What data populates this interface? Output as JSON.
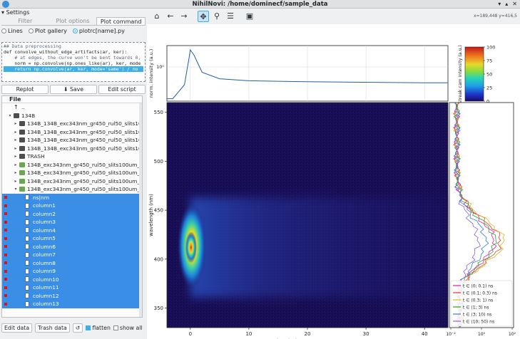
{
  "window": {
    "title": "NihilNovi: /home/dominecf/sample_data"
  },
  "settings": {
    "header": "Settings",
    "tabs": [
      "Filter",
      "Plot options",
      "Plot command"
    ],
    "radios": [
      {
        "label": "Lines",
        "checked": false
      },
      {
        "label": "Plot gallery",
        "checked": false
      },
      {
        "label": "plotrc[name].py",
        "checked": true
      }
    ],
    "code_lines": [
      "## Data preprocessing",
      "def convolve_without_edge_artifacts(ar, ker):",
      "    # at edges, the curve won't be bent towards 0,",
      "    norm = np.convolve(np.ones_like(ar), ker, mode",
      "    return np.convolve(ar, ker, mode='same') / no"
    ],
    "buttons": {
      "replot": "Replot",
      "save": "Save",
      "edit_script": "Edit script"
    }
  },
  "tree": {
    "header": "File",
    "rows": [
      {
        "label": "..",
        "indent": 1,
        "type": "up",
        "arrow": ""
      },
      {
        "label": "134B",
        "indent": 1,
        "type": "folder",
        "arrow": "▾"
      },
      {
        "label": "134B_134B_exc343nm_gr450_rul50_slits100um_5",
        "indent": 2,
        "type": "folder",
        "arrow": "▸"
      },
      {
        "label": "134B_134B_exc343nm_gr450_rul50_slits100um_5",
        "indent": 2,
        "type": "folder",
        "arrow": "▸"
      },
      {
        "label": "134B_134B_exc343nm_gr450_rul50_slits100um_5",
        "indent": 2,
        "type": "folder",
        "arrow": "▸"
      },
      {
        "label": "134B_134B_exc343nm_gr450_rul50_slits100um_5",
        "indent": 2,
        "type": "folder",
        "arrow": "▸"
      },
      {
        "label": "TRASH",
        "indent": 2,
        "type": "folder",
        "arrow": "▸"
      },
      {
        "label": "134B_exc343nm_gr450_rul50_slits100um_50um_",
        "indent": 2,
        "type": "green",
        "arrow": "▸"
      },
      {
        "label": "134B_exc343nm_gr450_rul50_slits100um_50um_",
        "indent": 2,
        "type": "green",
        "arrow": "▸"
      },
      {
        "label": "134B_exc343nm_gr450_rul50_slits100um_50um_",
        "indent": 2,
        "type": "green",
        "arrow": "▸"
      },
      {
        "label": "134B_exc343nm_gr450_rul50_slits100um_50um_",
        "indent": 2,
        "type": "green",
        "arrow": "▾"
      },
      {
        "label": "ns|nm",
        "indent": 3,
        "type": "file",
        "sel": true
      },
      {
        "label": "column1",
        "indent": 3,
        "type": "file",
        "sel": true
      },
      {
        "label": "column2",
        "indent": 3,
        "type": "file",
        "sel": true
      },
      {
        "label": "column3",
        "indent": 3,
        "type": "file",
        "sel": true
      },
      {
        "label": "column4",
        "indent": 3,
        "type": "file",
        "sel": true
      },
      {
        "label": "column5",
        "indent": 3,
        "type": "file",
        "sel": true
      },
      {
        "label": "column6",
        "indent": 3,
        "type": "file",
        "sel": true
      },
      {
        "label": "column7",
        "indent": 3,
        "type": "file",
        "sel": true
      },
      {
        "label": "column8",
        "indent": 3,
        "type": "file",
        "sel": true
      },
      {
        "label": "column9",
        "indent": 3,
        "type": "file",
        "sel": true
      },
      {
        "label": "column10",
        "indent": 3,
        "type": "file",
        "sel": true
      },
      {
        "label": "column11",
        "indent": 3,
        "type": "file",
        "sel": true
      },
      {
        "label": "column12",
        "indent": 3,
        "type": "file",
        "sel": true
      },
      {
        "label": "column13",
        "indent": 3,
        "type": "file",
        "sel": true
      }
    ]
  },
  "bottom": {
    "edit_data": "Edit data",
    "trash_data": "Trash data",
    "refresh": "↺",
    "flatten": "flatten",
    "flatten_checked": true,
    "show_all": "show all",
    "show_all_checked": false
  },
  "toolbar": {
    "tools": [
      {
        "name": "home-icon",
        "glyph": "⌂"
      },
      {
        "name": "back-icon",
        "glyph": "←"
      },
      {
        "name": "forward-icon",
        "glyph": "→"
      },
      {
        "name": "pan-icon",
        "glyph": "✥",
        "active": true
      },
      {
        "name": "zoom-icon",
        "glyph": "⚲"
      },
      {
        "name": "configure-icon",
        "glyph": "☰"
      },
      {
        "name": "save-figure-icon",
        "glyph": "▣"
      }
    ],
    "coords": "x=189,448   y=416,5"
  },
  "chart_data": [
    {
      "type": "line",
      "ylabel": "norm. intensity (a.u.)",
      "yticks": [
        "10⁰"
      ],
      "series": [
        {
          "values": [
            [
              -3,
              0.02
            ],
            [
              -1,
              0.3
            ],
            [
              -0.2,
              0.85
            ],
            [
              0,
              1.0
            ],
            [
              0.6,
              0.9
            ],
            [
              2,
              0.55
            ],
            [
              5,
              0.42
            ],
            [
              10,
              0.38
            ],
            [
              20,
              0.36
            ],
            [
              30,
              0.35
            ],
            [
              40,
              0.34
            ],
            [
              44,
              0.34
            ]
          ]
        }
      ]
    },
    {
      "type": "heatmap",
      "xlabel": "time (ns)",
      "ylabel": "wavelength (nm)",
      "xlim": [
        -4,
        44
      ],
      "ylim": [
        330,
        560
      ],
      "xticks": [
        0,
        10,
        20,
        30,
        40
      ],
      "yticks": [
        350,
        400,
        450,
        500,
        550
      ],
      "peak": {
        "x": 0,
        "y": 412
      }
    },
    {
      "type": "colorbar",
      "ylabel": "streak cam intensity (a.u.)",
      "ticks": [
        0,
        25,
        50,
        75,
        100
      ],
      "range": [
        0,
        100
      ]
    },
    {
      "type": "line",
      "xlabel": "mean intensity (a.u.)",
      "xticks": [
        "10⁻²",
        "10⁰",
        "10²"
      ],
      "series": [
        {
          "name": "t ∈ ⟨0; 0.1) ns",
          "color": "#e01fa0",
          "peak": 0.8
        },
        {
          "name": "t ∈ ⟨0.1; 0.3) ns",
          "color": "#e03c3c",
          "peak": 0.93
        },
        {
          "name": "t ∈ ⟨0.3; 1) ns",
          "color": "#d9b712",
          "peak": 1.0
        },
        {
          "name": "t ∈ ⟨1; 3) ns",
          "color": "#2ba02b",
          "peak": 0.82
        },
        {
          "name": "t ∈ ⟨3; 10) ns",
          "color": "#2f7fd4",
          "peak": 0.62
        },
        {
          "name": "t ∈ ⟨10; 50) ns",
          "color": "#8a5fd6",
          "peak": 0.45
        }
      ]
    }
  ]
}
